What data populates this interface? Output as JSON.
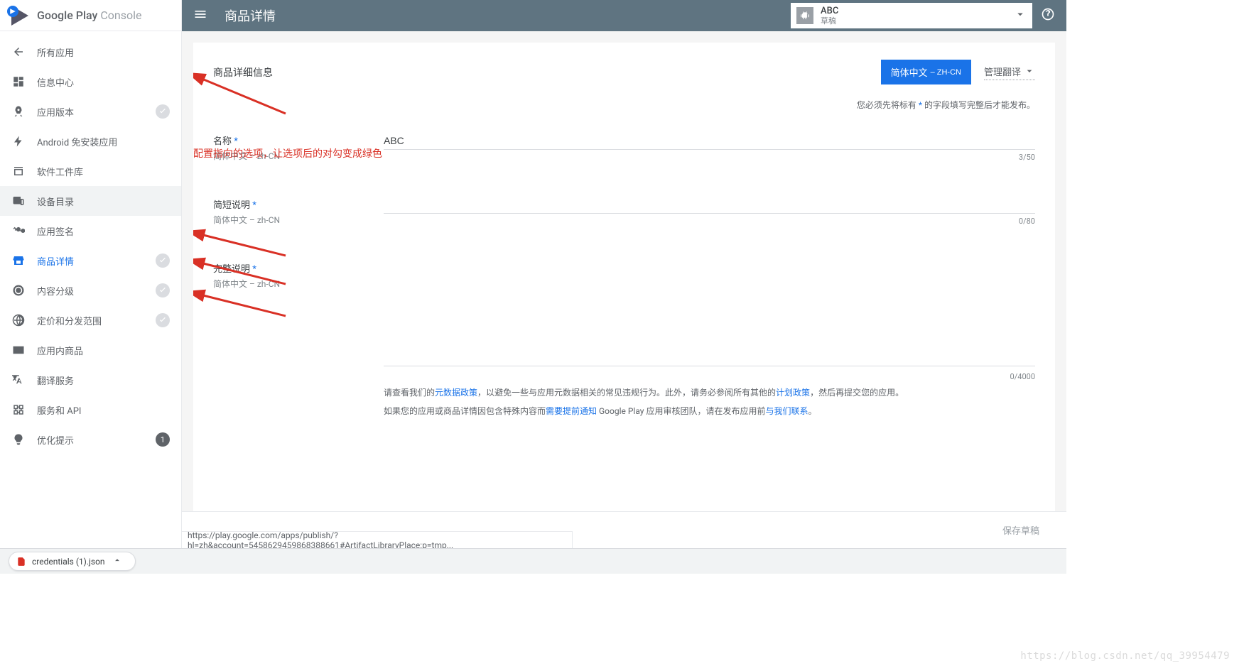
{
  "logo": {
    "text1": "Google Play",
    "text2": " Console"
  },
  "header": {
    "title": "商品详情",
    "app_selector": {
      "name": "ABC",
      "status": "草稿"
    }
  },
  "sidebar": {
    "items": [
      {
        "label": "所有应用",
        "icon": "arrow-back"
      },
      {
        "label": "信息中心",
        "icon": "dashboard"
      },
      {
        "label": "应用版本",
        "icon": "rocket",
        "check": true
      },
      {
        "label": "Android 免安装应用",
        "icon": "bolt"
      },
      {
        "label": "软件工件库",
        "icon": "library"
      },
      {
        "label": "设备目录",
        "icon": "devices",
        "highlighted": true
      },
      {
        "label": "应用签名",
        "icon": "key"
      },
      {
        "label": "商品详情",
        "icon": "store",
        "check": true,
        "active": true
      },
      {
        "label": "内容分级",
        "icon": "rating",
        "check": true
      },
      {
        "label": "定价和分发范围",
        "icon": "globe",
        "check": true
      },
      {
        "label": "应用内商品",
        "icon": "card"
      },
      {
        "label": "翻译服务",
        "icon": "translate"
      },
      {
        "label": "服务和 API",
        "icon": "api"
      },
      {
        "label": "优化提示",
        "icon": "bulb",
        "badge": "1"
      }
    ]
  },
  "content": {
    "card_title": "商品详细信息",
    "lang_button_main": "简体中文",
    "lang_button_sub": " – ZH-CN",
    "manage_translations": "管理翻译",
    "required_note_pre": "您必须先将标有 ",
    "required_note_star": "*",
    "required_note_post": " 的字段填写完整后才能发布。",
    "name": {
      "label": "名称",
      "sublabel": "简体中文 – zh-CN",
      "value": "ABC",
      "count": "3/50"
    },
    "short_desc": {
      "label": "简短说明",
      "sublabel": "简体中文 – zh-CN",
      "value": "",
      "count": "0/80"
    },
    "full_desc": {
      "label": "完整说明",
      "sublabel": "简体中文 – zh-CN",
      "value": "",
      "count": "0/4000"
    },
    "policy1_pre": "请查看我们的",
    "policy1_link1": "元数据政策",
    "policy1_mid": "，以避免一些与应用元数据相关的常见违规行为。此外，请务必参阅所有其他的",
    "policy1_link2": "计划政策",
    "policy1_post": "，然后再提交您的应用。",
    "policy2_pre": "如果您的应用或商品详情因包含特殊内容而",
    "policy2_link1": "需要提前通知",
    "policy2_mid": " Google Play 应用审核团队，请在发布应用前",
    "policy2_link2": "与我们联系",
    "policy2_post": "。"
  },
  "annotation": {
    "text": "配置指向的选项，让选项后的对勾变成绿色"
  },
  "footer": {
    "save_draft": "保存草稿"
  },
  "status_url": "https://play.google.com/apps/publish/?hl=zh&account=5458629459868388661#ArtifactLibraryPlace:p=tmp...",
  "download": {
    "filename": "credentials (1).json"
  },
  "watermark": "https://blog.csdn.net/qq_39954479"
}
